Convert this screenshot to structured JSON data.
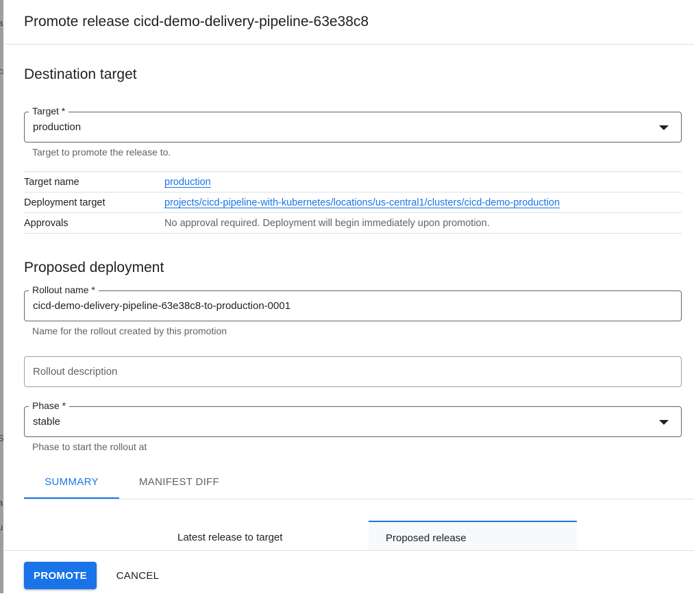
{
  "dialog": {
    "title": "Promote release cicd-demo-delivery-pipeline-63e38c8"
  },
  "destination": {
    "heading": "Destination target",
    "target_field": {
      "label": "Target *",
      "value": "production",
      "hint": "Target to promote the release to."
    },
    "details": [
      {
        "key": "Target name",
        "value": "production",
        "is_link": true
      },
      {
        "key": "Deployment target",
        "value": "projects/cicd-pipeline-with-kubernetes/locations/us-central1/clusters/cicd-demo-production",
        "is_link": true
      },
      {
        "key": "Approvals",
        "value": "No approval required. Deployment will begin immediately upon promotion.",
        "is_link": false
      }
    ]
  },
  "proposed": {
    "heading": "Proposed deployment",
    "rollout_name": {
      "label": "Rollout name *",
      "value": "cicd-demo-delivery-pipeline-63e38c8-to-production-0001",
      "hint": "Name for the rollout created by this promotion"
    },
    "rollout_description": {
      "placeholder": "Rollout description"
    },
    "phase": {
      "label": "Phase *",
      "value": "stable",
      "hint": "Phase to start the rollout at"
    }
  },
  "tabs": [
    {
      "label": "SUMMARY",
      "active": true
    },
    {
      "label": "MANIFEST DIFF",
      "active": false
    }
  ],
  "summary": {
    "latest_header": "Latest release to target",
    "proposed_header": "Proposed release"
  },
  "footer": {
    "promote_label": "PROMOTE",
    "cancel_label": "CANCEL"
  },
  "backdrop_glyphs": [
    "a",
    "cr",
    "S",
    "a",
    "u"
  ],
  "colors": {
    "accent": "#1a73e8",
    "text_primary": "#202124",
    "text_secondary": "#5f6368",
    "divider": "#e0e0e0"
  }
}
